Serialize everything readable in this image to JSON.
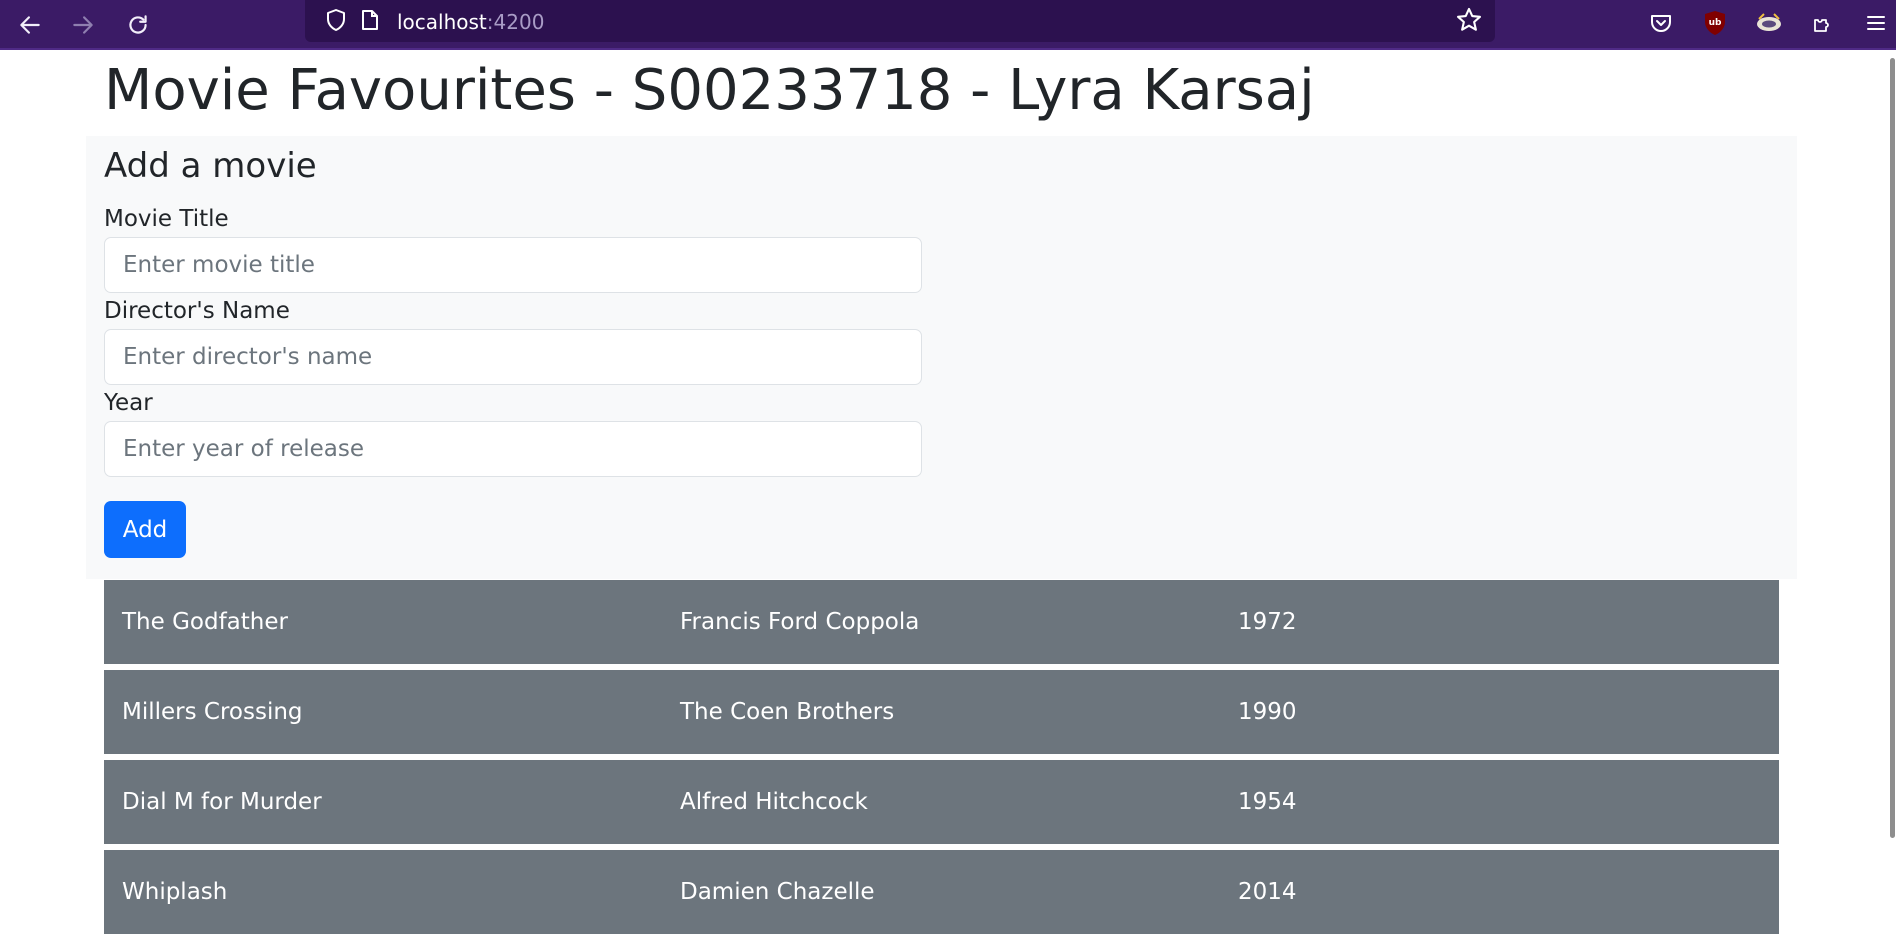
{
  "browser": {
    "url_host": "localhost",
    "url_port": ":4200",
    "icons": [
      "back-arrow-icon",
      "forward-arrow-icon",
      "reload-icon",
      "shield-icon",
      "page-icon",
      "star-icon",
      "pocket-icon",
      "ublock-icon",
      "extension-icon",
      "puzzle-icon",
      "menu-icon"
    ],
    "theme_color": "#3b1b66"
  },
  "page": {
    "title": "Movie Favourites - S00233718 - Lyra Karsaj"
  },
  "form": {
    "heading": "Add a movie",
    "title_label": "Movie Title",
    "title_placeholder": "Enter movie title",
    "director_label": "Director's Name",
    "director_placeholder": "Enter director's name",
    "year_label": "Year",
    "year_placeholder": "Enter year of release",
    "add_label": "Add",
    "button_color": "#0d6efd"
  },
  "movies": [
    {
      "title": "The Godfather",
      "director": "Francis Ford Coppola",
      "year": "1972"
    },
    {
      "title": "Millers Crossing",
      "director": "The Coen Brothers",
      "year": "1990"
    },
    {
      "title": "Dial M for Murder",
      "director": "Alfred Hitchcock",
      "year": "1954"
    },
    {
      "title": "Whiplash",
      "director": "Damien Chazelle",
      "year": "2014"
    }
  ],
  "row_color": "#6c757d"
}
